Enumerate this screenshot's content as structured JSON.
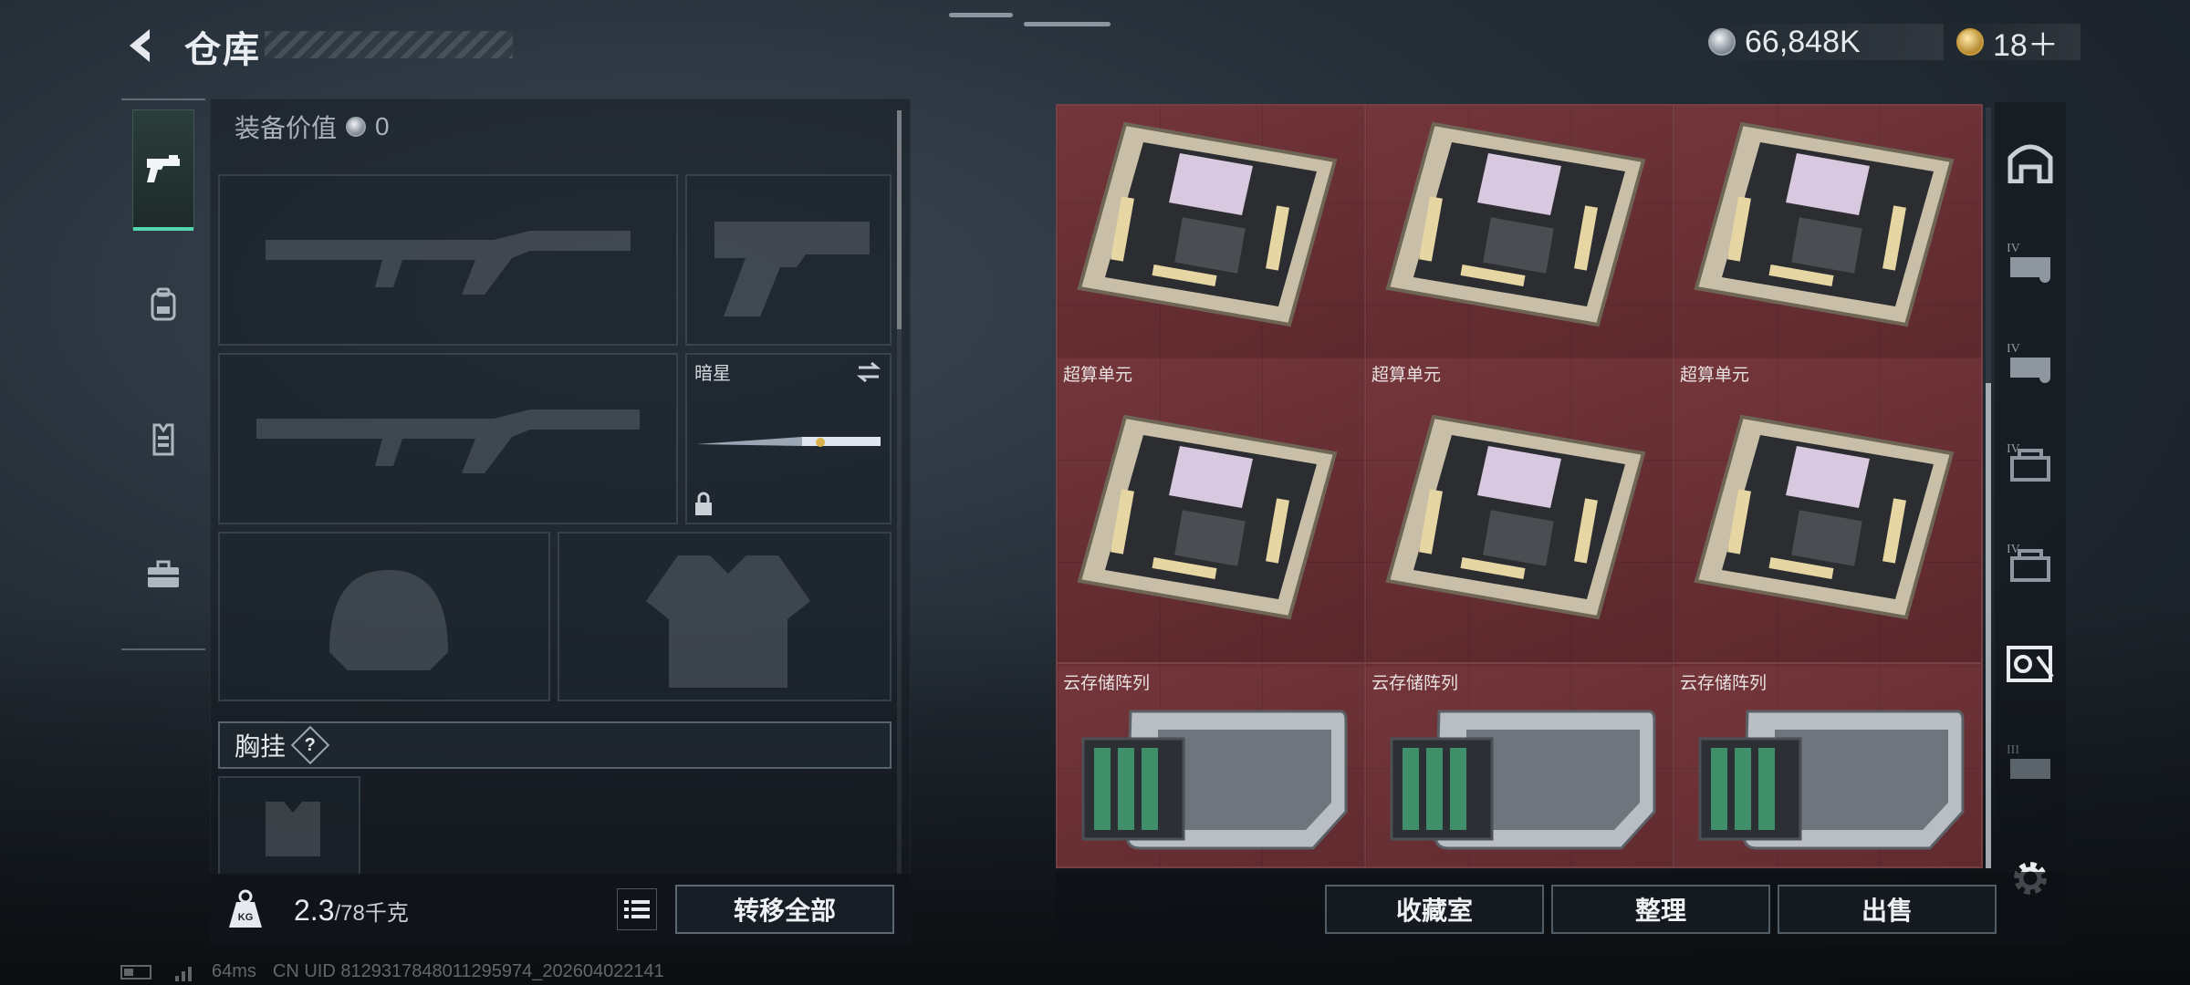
{
  "header": {
    "title": "仓库",
    "silver_amount": "66,848K",
    "gold_amount": "18＋"
  },
  "tabs": [
    {
      "name": "pistol",
      "active": true
    },
    {
      "name": "backpack",
      "active": false
    },
    {
      "name": "vest",
      "active": false
    },
    {
      "name": "case",
      "active": false
    }
  ],
  "equipment": {
    "value_label": "装备价值",
    "value_amount": "0",
    "melee_name": "暗星",
    "chest_label": "胸挂",
    "chest_help": "?"
  },
  "weight": {
    "current": "2.3",
    "capacity": "/78千克",
    "unit_icon_text": "KG"
  },
  "buttons": {
    "transfer_all": "转移全部",
    "collection": "收藏室",
    "organize": "整理",
    "sell": "出售"
  },
  "storage": {
    "items": [
      {
        "name": "",
        "type": "compute-unit"
      },
      {
        "name": "",
        "type": "compute-unit"
      },
      {
        "name": "",
        "type": "compute-unit"
      },
      {
        "name": "超算单元",
        "type": "compute-unit"
      },
      {
        "name": "超算单元",
        "type": "compute-unit"
      },
      {
        "name": "超算单元",
        "type": "compute-unit"
      },
      {
        "name": "云存储阵列",
        "type": "storage-array"
      },
      {
        "name": "云存储阵列",
        "type": "storage-array"
      },
      {
        "name": "云存储阵列",
        "type": "storage-array"
      }
    ]
  },
  "rail": {
    "tier_labels": [
      "IV",
      "IV",
      "IV",
      "IV",
      "III"
    ]
  },
  "status": {
    "ping": "64ms",
    "uid": "CN UID 8129317848011295974_202604022141"
  },
  "colors": {
    "accent": "#53d7b0",
    "storage_bg": "#6b2f33"
  }
}
